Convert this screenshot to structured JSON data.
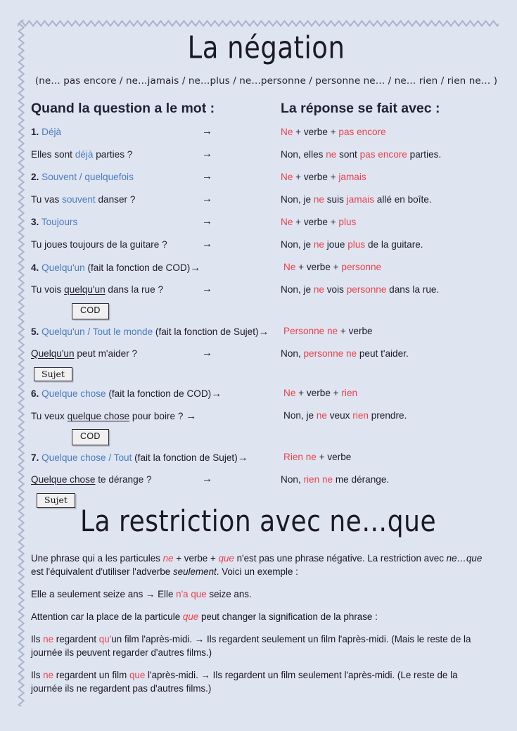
{
  "document": {
    "title": "La négation",
    "subtitle": "(ne… pas encore / ne…jamais / ne…plus / ne…personne / personne ne… / ne… rien / rien ne… )",
    "second_title": "La restriction avec ne…que"
  },
  "colors": {
    "background": "#dfe4f1",
    "heading": "#1f2237",
    "keyword_blue": "#4a7cc0",
    "keyword_red": "#e8434b",
    "body_text": "#15151f",
    "box_border": "#2b2b33",
    "box_fill": "#f0f0f0",
    "stitch": "#9aa7c4"
  },
  "columns": {
    "left_header": "Quand la question a le mot :",
    "right_header": "La réponse se fait avec :"
  },
  "arrow": "→",
  "entries": [
    {
      "id": 1,
      "number": "1.",
      "keyword": "Déjà",
      "rule_pre": "Ne",
      "rule_mid": " + verbe + ",
      "rule_post": "pas encore",
      "example_q_pre": "Elles sont ",
      "example_q_kw": "déjà",
      "example_q_post": " parties ?",
      "example_a_1": "Non, elles ",
      "example_a_kw1": "ne",
      "example_a_2": " sont ",
      "example_a_kw2": "pas encore",
      "example_a_3": " parties."
    },
    {
      "id": 2,
      "number": "2.",
      "keyword": "Souvent / quelquefois",
      "rule_pre": "Ne",
      "rule_mid": " + verbe + ",
      "rule_post": "jamais",
      "example_q_pre": "Tu vas ",
      "example_q_kw": "souvent",
      "example_q_post": " danser ?",
      "example_a_1": "Non, je ",
      "example_a_kw1": "ne",
      "example_a_2": " suis ",
      "example_a_kw2": "jamais",
      "example_a_3": " allé en boîte."
    },
    {
      "id": 3,
      "number": "3.",
      "keyword": "Toujours",
      "rule_pre": "Ne",
      "rule_mid": " + verbe + ",
      "rule_post": "plus",
      "example_q_pre": "Tu joues toujours de la guitare ?",
      "example_q_kw": "",
      "example_q_post": "",
      "example_a_1": "Non, je ",
      "example_a_kw1": "ne",
      "example_a_2": " joue ",
      "example_a_kw2": "plus",
      "example_a_3": " de la guitare."
    },
    {
      "id": 4,
      "number": "4.",
      "keyword": "Quelqu'un",
      "func": " (fait la fonction de COD)",
      "rule_pre": "Ne",
      "rule_mid": " + verbe + ",
      "rule_post": "personne",
      "example_q_pre": "Tu vois ",
      "example_q_kw": "quelqu'un",
      "example_q_post": " dans la rue ?",
      "example_a_1": "Non, je ",
      "example_a_kw1": "ne",
      "example_a_2": " vois ",
      "example_a_kw2": "personne",
      "example_a_3": " dans la rue.",
      "tag": "COD"
    },
    {
      "id": 5,
      "number": "5.",
      "keyword": "Quelqu'un / Tout le monde",
      "func": " (fait la fonction de Sujet)",
      "rule_pre": "Personne ne",
      "rule_mid": " + verbe",
      "rule_post": "",
      "example_q_pre": "",
      "example_q_kw": "Quelqu'un",
      "example_q_post": " peut m'aider ?",
      "example_a_1": "Non, ",
      "example_a_kw1": "personne ne",
      "example_a_2": " peut t'aider.",
      "example_a_kw2": "",
      "example_a_3": "",
      "tag": "Sujet"
    },
    {
      "id": 6,
      "number": "6.",
      "keyword": "Quelque chose ",
      "func": " (fait la fonction de COD)",
      "rule_pre": "Ne",
      "rule_mid": " + verbe + ",
      "rule_post": "rien",
      "example_q_pre": "Tu veux ",
      "example_q_kw": "quelque chose",
      "example_q_post": " pour boire ?",
      "example_a_1": "Non, je ",
      "example_a_kw1": "ne",
      "example_a_2": " veux ",
      "example_a_kw2": "rien",
      "example_a_3": " prendre.",
      "tag": "COD"
    },
    {
      "id": 7,
      "number": "7.",
      "keyword": "Quelque chose / Tout",
      "func": " (fait la fonction de Sujet)",
      "rule_pre": "Rien ne",
      "rule_mid": " + verbe",
      "rule_post": "",
      "example_q_pre": "",
      "example_q_kw": "Quelque chose",
      "example_q_post": " te dérange ?",
      "example_a_1": "Non, ",
      "example_a_kw1": "rien ne",
      "example_a_2": " me dérange.",
      "example_a_kw2": "",
      "example_a_3": "",
      "tag": "Sujet"
    }
  ],
  "restriction": {
    "p1_a": "Une phrase qui a les particules ",
    "p1_ne": "ne",
    "p1_b": " + verbe + ",
    "p1_que": "que",
    "p1_c": " n'est pas une phrase négative. La restriction avec ",
    "p1_nq": "ne…que",
    "p1_d": " est l'équivalent d'utiliser l'adverbe ",
    "p1_seulement": "seulement",
    "p1_e": ". Voici un exemple :",
    "p2_a": "Elle a seulement seize ans → Elle ",
    "p2_na": "n'a",
    "p2_b": " ",
    "p2_que": "que",
    "p2_c": " seize ans.",
    "p3_a": "Attention car la place de la particule ",
    "p3_que": "que",
    "p3_b": " peut changer la signification de la phrase :",
    "p4_a": "Ils ",
    "p4_ne": "ne",
    "p4_b": " regardent ",
    "p4_qu": "qu'",
    "p4_c": "un film l'après-midi. → Ils regardent seulement un film l'après-midi. (Mais le reste de la journée ils peuvent regarder d'autres films.)",
    "p5_a": "Ils ",
    "p5_ne": "ne",
    "p5_b": " regardent un film ",
    "p5_que": "que",
    "p5_c": " l'après-midi. → Ils regardent un film seulement l'après-midi. (Le reste de la journée ils ne regardent pas d'autres films.)"
  }
}
